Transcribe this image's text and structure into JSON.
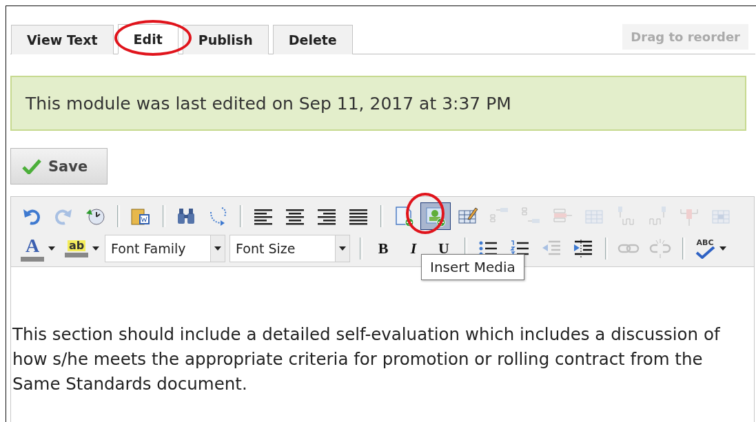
{
  "tabs": [
    {
      "label": "View Text",
      "selected": false
    },
    {
      "label": "Edit",
      "selected": true
    },
    {
      "label": "Publish",
      "selected": false
    },
    {
      "label": "Delete",
      "selected": false
    }
  ],
  "reorder_button": {
    "label": "Drag to reorder",
    "disabled": true
  },
  "notice": "This module was last edited on Sep 11, 2017 at 3:37 PM",
  "save_button": {
    "label": "Save"
  },
  "toolbar": [
    [
      {
        "kind": "button",
        "disabled": false,
        "hovered": false
      },
      {
        "kind": "button",
        "disabled": true,
        "hovered": false
      },
      {
        "kind": "button",
        "disabled": false,
        "hovered": false
      },
      {
        "kind": "separator"
      },
      {
        "kind": "button",
        "disabled": false,
        "hovered": false
      },
      {
        "kind": "separator"
      },
      {
        "kind": "button",
        "disabled": false,
        "hovered": false
      },
      {
        "kind": "button",
        "disabled": false,
        "hovered": false
      },
      {
        "kind": "separator"
      },
      {
        "kind": "button",
        "disabled": false,
        "hovered": false
      },
      {
        "kind": "button",
        "disabled": false,
        "hovered": false
      },
      {
        "kind": "button",
        "disabled": false,
        "hovered": false
      },
      {
        "kind": "button",
        "disabled": false,
        "hovered": false
      },
      {
        "kind": "separator"
      },
      {
        "kind": "button",
        "disabled": false,
        "hovered": false
      },
      {
        "kind": "button",
        "disabled": false,
        "hovered": true
      },
      {
        "kind": "button",
        "disabled": false,
        "hovered": false
      },
      {
        "kind": "button",
        "disabled": true,
        "hovered": false
      },
      {
        "kind": "button",
        "disabled": true,
        "hovered": false
      },
      {
        "kind": "button",
        "disabled": true,
        "hovered": false
      },
      {
        "kind": "button",
        "disabled": true,
        "hovered": false
      },
      {
        "kind": "button",
        "disabled": true,
        "hovered": false
      },
      {
        "kind": "button",
        "disabled": true,
        "hovered": false
      },
      {
        "kind": "button",
        "disabled": true,
        "hovered": false
      },
      {
        "kind": "button",
        "disabled": true,
        "hovered": false
      }
    ],
    [
      {
        "kind": "split",
        "glyph": "A"
      },
      {
        "kind": "split",
        "glyph": "ab"
      },
      {
        "kind": "select",
        "value": "Font Family"
      },
      {
        "kind": "select",
        "value": "Font Size"
      },
      {
        "kind": "separator"
      },
      {
        "kind": "letter",
        "glyph": "B"
      },
      {
        "kind": "letter",
        "glyph": "I"
      },
      {
        "kind": "letter",
        "glyph": "U"
      },
      {
        "kind": "separator"
      },
      {
        "kind": "button",
        "disabled": false,
        "hovered": false
      },
      {
        "kind": "button",
        "disabled": false,
        "hovered": false
      },
      {
        "kind": "button",
        "disabled": true,
        "hovered": false
      },
      {
        "kind": "button",
        "disabled": false,
        "hovered": false
      },
      {
        "kind": "separator"
      },
      {
        "kind": "button",
        "disabled": true,
        "hovered": false
      },
      {
        "kind": "button",
        "disabled": true,
        "hovered": false
      },
      {
        "kind": "separator"
      },
      {
        "kind": "split",
        "glyph": "ABC"
      }
    ]
  ],
  "tooltip": "Insert Media",
  "content": "This section should include a detailed self-evaluation which includes a discussion of how s/he meets the appropriate criteria for promotion or rolling contract from the Same Standards document."
}
